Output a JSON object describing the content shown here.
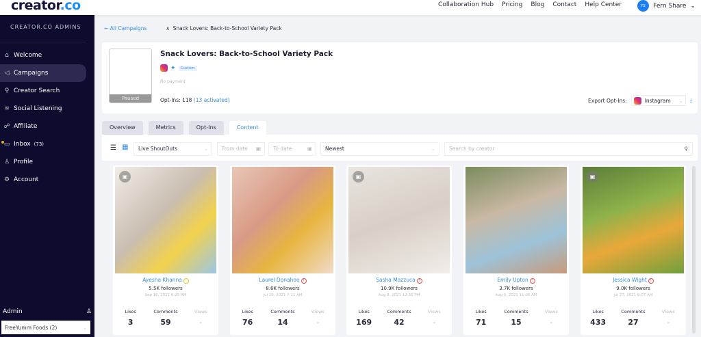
{
  "header": {
    "logo": "creator.co",
    "nav": [
      "Collaboration Hub",
      "Pricing",
      "Blog",
      "Contact",
      "Help Center"
    ],
    "user_initials": "FS",
    "user_name": "Fern Share"
  },
  "sidebar": {
    "title": "CREATOR.CO ADMINS",
    "items": [
      {
        "label": "Welcome",
        "icon": "home-icon"
      },
      {
        "label": "Campaigns",
        "icon": "megaphone-icon"
      },
      {
        "label": "Creator Search",
        "icon": "search-icon"
      },
      {
        "label": "Social Listening",
        "icon": "signal-icon"
      },
      {
        "label": "Affiliate",
        "icon": "users-icon"
      },
      {
        "label": "Inbox",
        "count": "(73)",
        "icon": "inbox-icon"
      },
      {
        "label": "Profile",
        "icon": "user-icon"
      },
      {
        "label": "Account",
        "icon": "gear-icon"
      }
    ],
    "admin_label": "Admin",
    "org": "FreeYumm Foods (2)"
  },
  "breadcrumb": {
    "back": "All Campaigns",
    "current": "Snack Lovers: Back-to-School Variety Pack"
  },
  "campaign": {
    "status": "Paused",
    "title": "Snack Lovers: Back-to-School Variety Pack",
    "badge": "Custom",
    "payment": "No payment",
    "optins_label": "Opt-Ins: 118",
    "optins_activated": "(13 activated)",
    "export_label": "Export Opt-Ins:",
    "export_platform": "Instagram"
  },
  "tabs": [
    "Overview",
    "Metrics",
    "Opt-Ins",
    "Content"
  ],
  "filters": {
    "type": "Live ShoutOuts",
    "from": "From date",
    "to": "To date",
    "sort": "Newest",
    "search_placeholder": "Search by creator"
  },
  "stat_labels": {
    "likes": "Likes",
    "comments": "Comments",
    "views": "Views"
  },
  "posts": [
    {
      "name": "Ayesha Khanna",
      "followers": "5.5K followers",
      "date": "Sep 16, 2021 6:25 AM",
      "likes": "3",
      "comments": "59",
      "views": "-",
      "status_color": "#e8c830"
    },
    {
      "name": "Laurel Donahoo",
      "followers": "8.6K followers",
      "date": "Jul 19, 2021 7:11 AM",
      "likes": "76",
      "comments": "14",
      "views": "-",
      "status_color": "#e84a4a"
    },
    {
      "name": "Sasha Mazzuca",
      "followers": "10.9K followers",
      "date": "Aug 8, 2021 12:36 PM",
      "likes": "169",
      "comments": "42",
      "views": "-",
      "status_color": "#e84a4a"
    },
    {
      "name": "Emily Upton",
      "followers": "3.7K followers",
      "date": "Aug 5, 2021 11:06 AM",
      "likes": "71",
      "comments": "15",
      "views": "-",
      "status_color": "#e84a4a"
    },
    {
      "name": "Jessica Wight",
      "followers": "9.0K followers",
      "date": "Jul 27, 2021 8:07 AM",
      "likes": "433",
      "comments": "27",
      "views": "-",
      "status_color": "#e84a4a"
    }
  ]
}
